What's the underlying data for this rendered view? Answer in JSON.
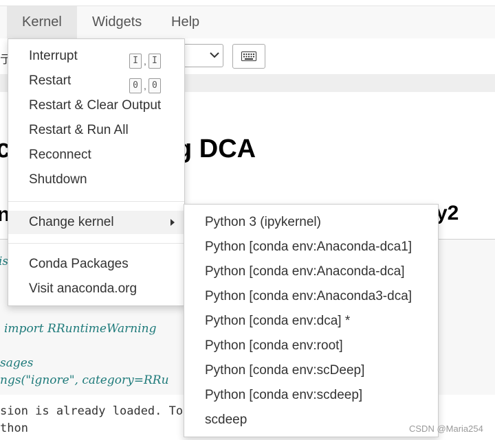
{
  "menubar": {
    "items": [
      {
        "label": "Kernel"
      },
      {
        "label": "Widgets"
      },
      {
        "label": "Help"
      }
    ]
  },
  "toolbar": {
    "left_fragment": "亍",
    "keyboard_icon": "keyboard-icon"
  },
  "notebook": {
    "heading1_left": "c",
    "heading1_right": "g DCA",
    "heading2_left": "n",
    "heading2_right": "y2",
    "code_lines": [
      "is",
      "import RRuntimeWarning",
      "sages",
      "ngs(\"ignore\", category=RRu"
    ],
    "output_lines": [
      "sion is already loaded. To",
      "thon"
    ]
  },
  "kernel_menu": {
    "items": [
      {
        "label": "Interrupt",
        "shortcut": [
          "I",
          "I"
        ]
      },
      {
        "label": "Restart",
        "shortcut": [
          "0",
          "0"
        ]
      },
      {
        "label": "Restart & Clear Output"
      },
      {
        "label": "Restart & Run All"
      },
      {
        "label": "Reconnect"
      },
      {
        "label": "Shutdown"
      },
      {
        "label": "Change kernel"
      },
      {
        "label": "Conda Packages"
      },
      {
        "label": "Visit anaconda.org"
      }
    ]
  },
  "change_kernel_submenu": {
    "items": [
      "Python 3 (ipykernel)",
      "Python [conda env:Anaconda-dca1]",
      "Python [conda env:Anaconda-dca]",
      "Python [conda env:Anaconda3-dca]",
      "Python [conda env:dca] *",
      "Python [conda env:root]",
      "Python [conda env:scDeep]",
      "Python [conda env:scdeep]",
      "scdeep"
    ]
  },
  "watermark": "CSDN @Maria254"
}
